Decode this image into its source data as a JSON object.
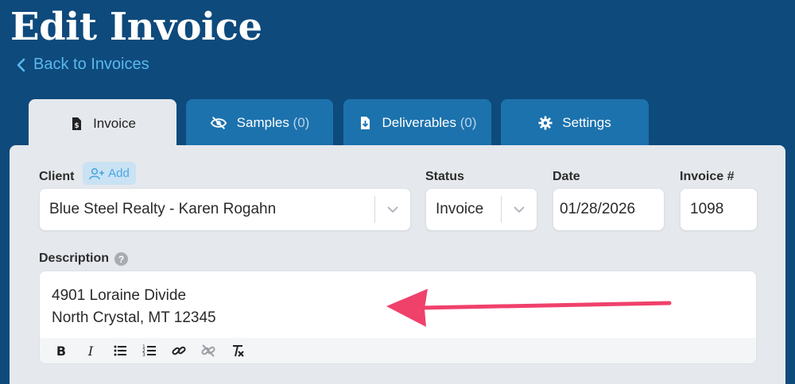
{
  "page": {
    "title": "Edit Invoice",
    "back_label": "Back to Invoices"
  },
  "tabs": [
    {
      "label": "Invoice",
      "count": "",
      "icon": "invoice-icon",
      "active": true
    },
    {
      "label": "Samples",
      "count": "(0)",
      "icon": "eye-slash-icon",
      "active": false
    },
    {
      "label": "Deliverables",
      "count": "(0)",
      "icon": "file-download-icon",
      "active": false
    },
    {
      "label": "Settings",
      "count": "",
      "icon": "gear-icon",
      "active": false
    }
  ],
  "form": {
    "client": {
      "label": "Client",
      "add_label": "Add",
      "value": "Blue Steel Realty - Karen Rogahn"
    },
    "status": {
      "label": "Status",
      "value": "Invoice"
    },
    "date": {
      "label": "Date",
      "value": "01/28/2026"
    },
    "invoice_number": {
      "label": "Invoice #",
      "value": "1098"
    },
    "description": {
      "label": "Description",
      "help_glyph": "?",
      "lines": [
        "4901 Loraine Divide",
        "North Crystal, MT 12345"
      ]
    }
  },
  "toolbar": [
    "bold-icon",
    "italic-icon",
    "bullet-list-icon",
    "numbered-list-icon",
    "link-icon",
    "unlink-icon",
    "clear-format-icon"
  ],
  "colors": {
    "background": "#0e4a7c",
    "tab": "#1c72ad",
    "panel": "#e5e8ec",
    "accent": "#5ab8ee",
    "arrow": "#f0416b"
  }
}
